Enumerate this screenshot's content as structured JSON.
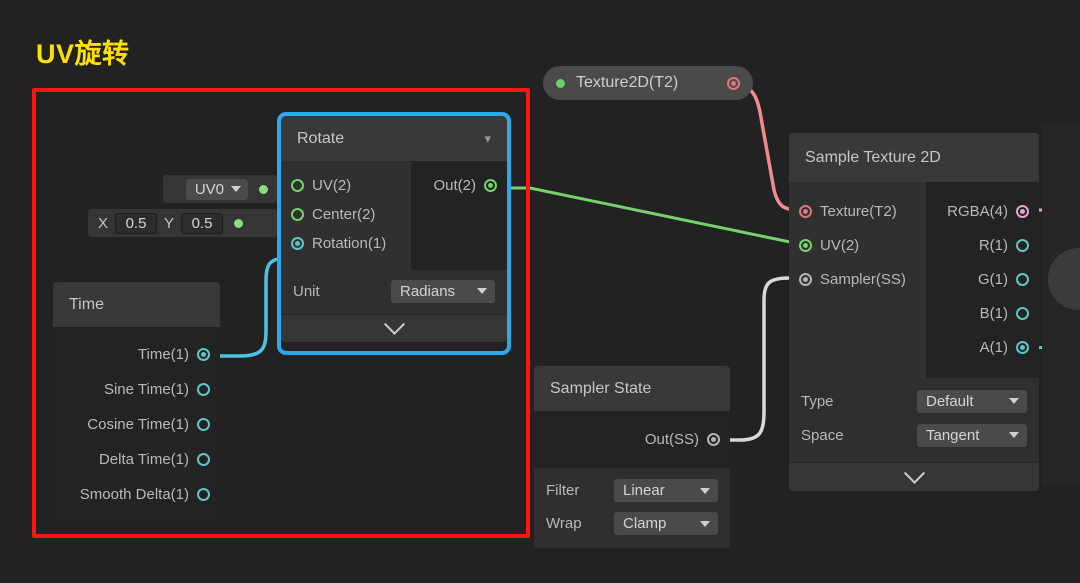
{
  "annotation": {
    "title": "UV旋转",
    "title_color": "#ffe000",
    "red_box_color": "#ff1414",
    "blue_box_color": "#2aa9ef"
  },
  "property_node": {
    "label": "Texture2D(T2)",
    "bulb_color": "#6fd06a",
    "out_port_color": "#e2747c"
  },
  "uv0_widget": {
    "value": "UV0",
    "dot_color": "#8ade84"
  },
  "vector_widget": {
    "x_label": "X",
    "x_value": "0.5",
    "y_label": "Y",
    "y_value": "0.5",
    "dot_color": "#8ade84"
  },
  "rotate_node": {
    "title": "Rotate",
    "inputs": [
      {
        "label": "UV(2)",
        "state": "connected-hollow",
        "color": "#74d36a"
      },
      {
        "label": "Center(2)",
        "state": "connected-hollow",
        "color": "#74d36a"
      },
      {
        "label": "Rotation(1)",
        "state": "connected-filled",
        "color": "#5ec7c5"
      }
    ],
    "outputs": [
      {
        "label": "Out(2)",
        "state": "connected-filled",
        "color": "#74d36a"
      }
    ],
    "settings": [
      {
        "label": "Unit",
        "value": "Radians"
      }
    ]
  },
  "time_node": {
    "title": "Time",
    "outputs": [
      {
        "label": "Time(1)",
        "state": "connected-filled",
        "color": "#5ec7c5"
      },
      {
        "label": "Sine Time(1)",
        "state": "hollow",
        "color": "#5ec7c5"
      },
      {
        "label": "Cosine Time(1)",
        "state": "hollow",
        "color": "#5ec7c5"
      },
      {
        "label": "Delta Time(1)",
        "state": "hollow",
        "color": "#5ec7c5"
      },
      {
        "label": "Smooth Delta(1)",
        "state": "hollow",
        "color": "#5ec7c5"
      }
    ]
  },
  "sampler_state_node": {
    "title": "Sampler State",
    "outputs": [
      {
        "label": "Out(SS)",
        "state": "connected-filled",
        "color": "#b4b4b4"
      }
    ],
    "settings": [
      {
        "label": "Filter",
        "value": "Linear"
      },
      {
        "label": "Wrap",
        "value": "Clamp"
      }
    ]
  },
  "sample_texture_node": {
    "title": "Sample Texture 2D",
    "inputs": [
      {
        "label": "Texture(T2)",
        "state": "connected-filled",
        "color": "#e2747c"
      },
      {
        "label": "UV(2)",
        "state": "connected-filled",
        "color": "#74d36a"
      },
      {
        "label": "Sampler(SS)",
        "state": "connected-filled",
        "color": "#b4b4b4"
      }
    ],
    "outputs": [
      {
        "label": "RGBA(4)",
        "state": "connected-filled",
        "color": "#e4a8d0"
      },
      {
        "label": "R(1)",
        "state": "hollow",
        "color": "#5ec7c5"
      },
      {
        "label": "G(1)",
        "state": "hollow",
        "color": "#5ec7c5"
      },
      {
        "label": "B(1)",
        "state": "hollow",
        "color": "#5ec7c5"
      },
      {
        "label": "A(1)",
        "state": "connected-filled",
        "color": "#5ec7c5"
      }
    ],
    "settings": [
      {
        "label": "Type",
        "value": "Default"
      },
      {
        "label": "Space",
        "value": "Tangent"
      }
    ]
  },
  "wires": [
    {
      "name": "uv0-to-rotate-uv",
      "color": "#74d36a"
    },
    {
      "name": "vector-to-rotate-center",
      "color": "#74d36a"
    },
    {
      "name": "time-to-rotate-rotation",
      "color": "#4ec3e0"
    },
    {
      "name": "rotate-out-to-sample-uv",
      "color": "#74d36a"
    },
    {
      "name": "texture2d-to-sample-texture",
      "color": "#f08b90"
    },
    {
      "name": "sampler-state-to-sample-sampler",
      "color": "#d8d8d8"
    },
    {
      "name": "rgba-out",
      "color": "#e4a8d0"
    },
    {
      "name": "alpha-out",
      "color": "#5ec7c5"
    }
  ]
}
